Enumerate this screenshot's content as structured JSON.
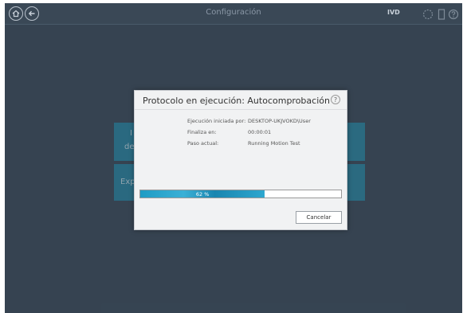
{
  "topbar": {
    "title": "Configuración",
    "ivd_label": "IVD"
  },
  "background_tiles": {
    "tile1_text_a": "I",
    "tile1_text_b": "de",
    "tile2_text": "Exp"
  },
  "dialog": {
    "title": "Protocolo en ejecución: Autocomprobación",
    "help_label": "?",
    "rows": [
      {
        "label": "Ejecución iniciada por:",
        "value": "DESKTOP-UKJVOKD\\User"
      },
      {
        "label": "Finaliza en:",
        "value": "00:00:01"
      },
      {
        "label": "Paso actual:",
        "value": "Running Motion Test"
      }
    ],
    "progress": {
      "percent": 62,
      "label": "62 %"
    },
    "cancel_label": "Cancelar"
  },
  "colors": {
    "background": "#3e4c5b",
    "accent": "#2c8aa8",
    "dialog": "#f1f2f3"
  },
  "icons": [
    "home-icon",
    "back-arrow-icon",
    "circle-status-icon",
    "document-icon",
    "help-icon"
  ]
}
